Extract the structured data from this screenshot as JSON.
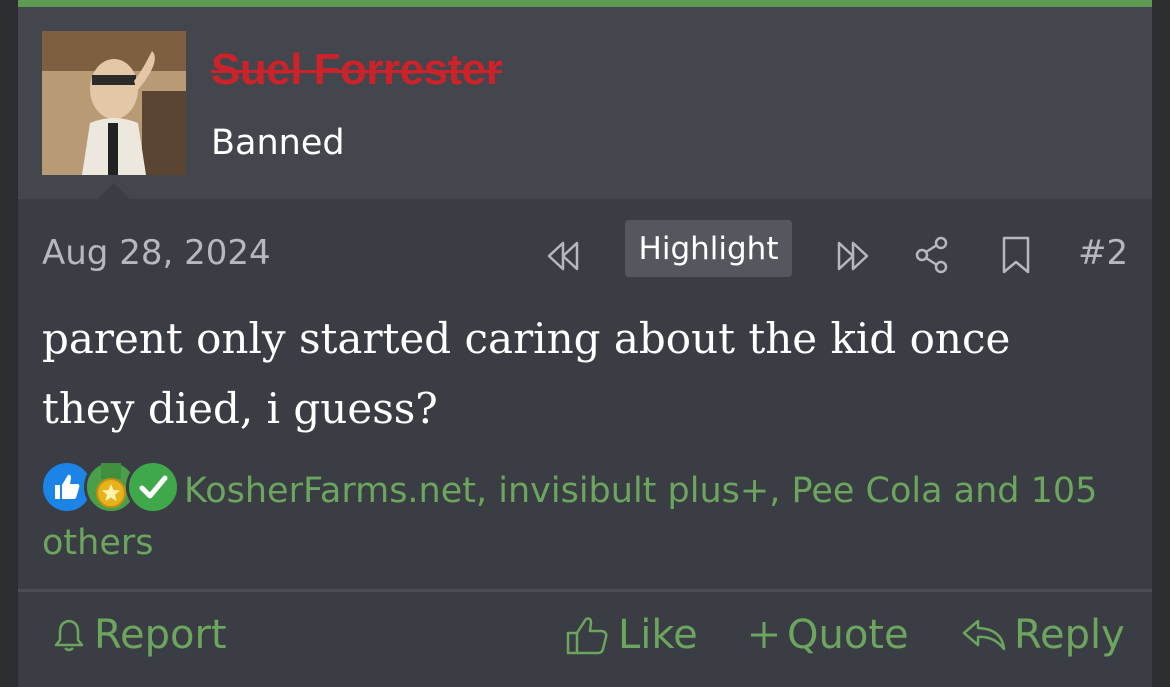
{
  "user": {
    "name": "Suel Forrester",
    "title": "Banned"
  },
  "post": {
    "date": "Aug 28, 2024",
    "highlight_label": "Highlight",
    "number": "#2",
    "body": "parent only started caring about the kid once they died, i guess?"
  },
  "reactions": {
    "icons": [
      "thumbs-up-icon",
      "medal-icon",
      "check-icon"
    ],
    "users_text": "KosherFarms.net, invisibult plus+, Pee Cola and 105 others"
  },
  "footer": {
    "report_label": "Report",
    "like_label": "Like",
    "quote_label": "Quote",
    "reply_label": "Reply"
  },
  "colors": {
    "accent_green": "#6ca55e",
    "banned_red": "#cc2229",
    "background": "#3a3d43"
  }
}
